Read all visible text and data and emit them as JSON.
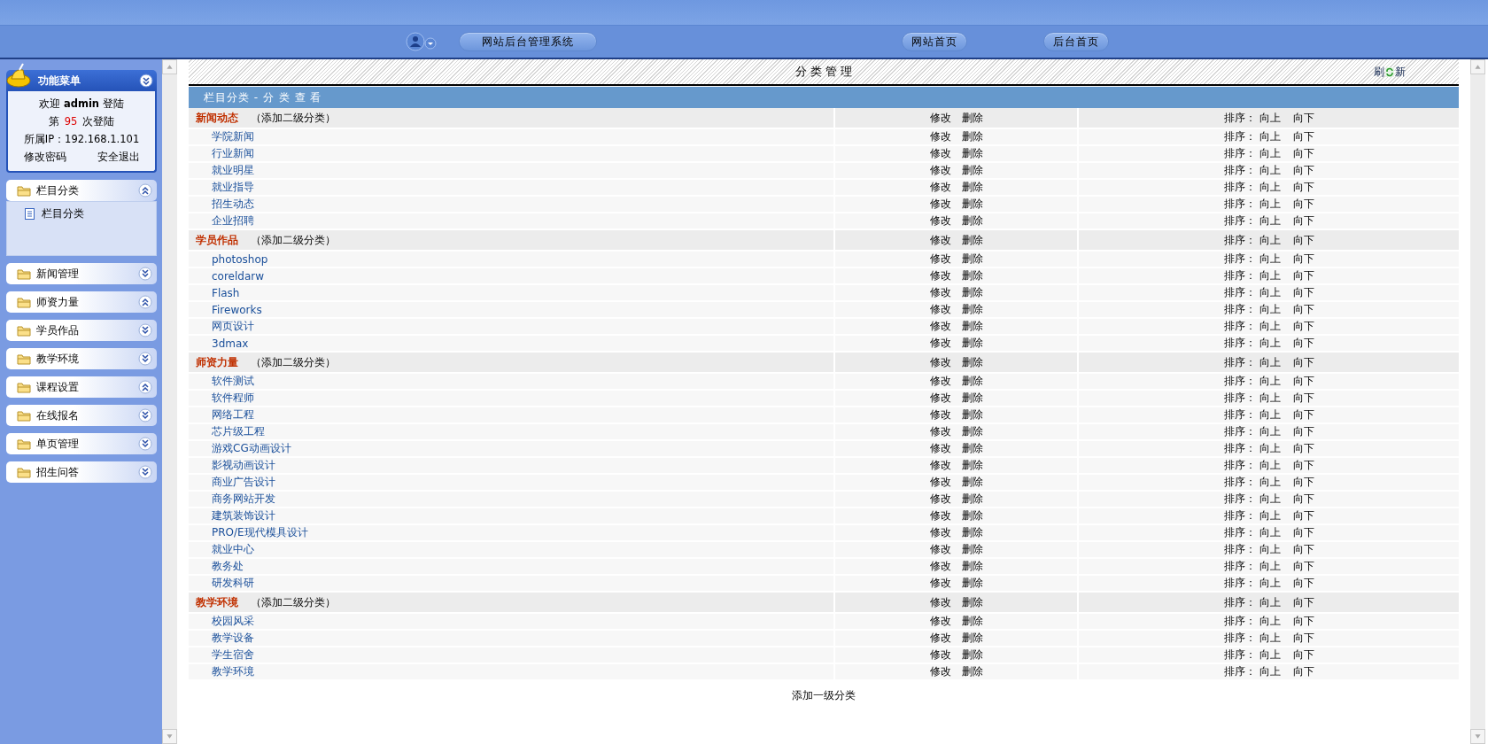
{
  "header": {
    "title_button": "网站后台管理系统",
    "nav_buttons": [
      "网站首页",
      "后台首页"
    ]
  },
  "sidebar": {
    "title": "功能菜单",
    "welcome": "欢迎 **admin** 登陆",
    "login_count": {
      "prefix": "第",
      "count": "95",
      "suffix": "次登陆"
    },
    "ip": "所属IP：192.168.1.101",
    "links": [
      "修改密码",
      "安全退出"
    ],
    "sections": [
      {
        "label": "栏目分类",
        "expanded": true,
        "children": [
          "栏目分类"
        ]
      },
      {
        "label": "新闻管理",
        "expanded": false
      },
      {
        "label": "师资力量",
        "expanded": true
      },
      {
        "label": "学员作品",
        "expanded": false
      },
      {
        "label": "教学环境",
        "expanded": false
      },
      {
        "label": "课程设置",
        "expanded": true
      },
      {
        "label": "在线报名",
        "expanded": false
      },
      {
        "label": "单页管理",
        "expanded": false
      },
      {
        "label": "招生问答",
        "expanded": false
      }
    ]
  },
  "panel": {
    "title": "分 类 管 理",
    "refresh": [
      "刷",
      "新"
    ],
    "subtitle": "栏目分类 - 分 类 查 看",
    "rows": [
      {
        "kind": "group",
        "name": "新闻动态",
        "add": "（添加二级分类）",
        "actions": [
          "修改",
          "删除"
        ],
        "sort": [
          "排序：",
          "向上",
          "向下"
        ]
      },
      {
        "kind": "child",
        "name": "学院新闻",
        "actions": [
          "修改",
          "删除"
        ],
        "sort": [
          "排序：",
          "向上",
          "向下"
        ]
      },
      {
        "kind": "child",
        "name": "行业新闻",
        "actions": [
          "修改",
          "删除"
        ],
        "sort": [
          "排序：",
          "向上",
          "向下"
        ]
      },
      {
        "kind": "child",
        "name": "就业明星",
        "actions": [
          "修改",
          "删除"
        ],
        "sort": [
          "排序：",
          "向上",
          "向下"
        ]
      },
      {
        "kind": "child",
        "name": "就业指导",
        "actions": [
          "修改",
          "删除"
        ],
        "sort": [
          "排序：",
          "向上",
          "向下"
        ]
      },
      {
        "kind": "child",
        "name": "招生动态",
        "actions": [
          "修改",
          "删除"
        ],
        "sort": [
          "排序：",
          "向上",
          "向下"
        ]
      },
      {
        "kind": "child",
        "name": "企业招聘",
        "actions": [
          "修改",
          "删除"
        ],
        "sort": [
          "排序：",
          "向上",
          "向下"
        ]
      },
      {
        "kind": "group",
        "name": "学员作品",
        "add": "（添加二级分类）",
        "actions": [
          "修改",
          "删除"
        ],
        "sort": [
          "排序：",
          "向上",
          "向下"
        ]
      },
      {
        "kind": "child",
        "name": "photoshop",
        "actions": [
          "修改",
          "删除"
        ],
        "sort": [
          "排序：",
          "向上",
          "向下"
        ]
      },
      {
        "kind": "child",
        "name": "coreldarw",
        "actions": [
          "修改",
          "删除"
        ],
        "sort": [
          "排序：",
          "向上",
          "向下"
        ]
      },
      {
        "kind": "child",
        "name": "Flash",
        "actions": [
          "修改",
          "删除"
        ],
        "sort": [
          "排序：",
          "向上",
          "向下"
        ]
      },
      {
        "kind": "child",
        "name": "Fireworks",
        "actions": [
          "修改",
          "删除"
        ],
        "sort": [
          "排序：",
          "向上",
          "向下"
        ]
      },
      {
        "kind": "child",
        "name": "网页设计",
        "actions": [
          "修改",
          "删除"
        ],
        "sort": [
          "排序：",
          "向上",
          "向下"
        ]
      },
      {
        "kind": "child",
        "name": "3dmax",
        "actions": [
          "修改",
          "删除"
        ],
        "sort": [
          "排序：",
          "向上",
          "向下"
        ]
      },
      {
        "kind": "group",
        "name": "师资力量",
        "add": "（添加二级分类）",
        "actions": [
          "修改",
          "删除"
        ],
        "sort": [
          "排序：",
          "向上",
          "向下"
        ]
      },
      {
        "kind": "child",
        "name": "软件测试",
        "actions": [
          "修改",
          "删除"
        ],
        "sort": [
          "排序：",
          "向上",
          "向下"
        ]
      },
      {
        "kind": "child",
        "name": "软件程师",
        "actions": [
          "修改",
          "删除"
        ],
        "sort": [
          "排序：",
          "向上",
          "向下"
        ]
      },
      {
        "kind": "child",
        "name": "网络工程",
        "actions": [
          "修改",
          "删除"
        ],
        "sort": [
          "排序：",
          "向上",
          "向下"
        ]
      },
      {
        "kind": "child",
        "name": "芯片级工程",
        "actions": [
          "修改",
          "删除"
        ],
        "sort": [
          "排序：",
          "向上",
          "向下"
        ]
      },
      {
        "kind": "child",
        "name": "游戏CG动画设计",
        "actions": [
          "修改",
          "删除"
        ],
        "sort": [
          "排序：",
          "向上",
          "向下"
        ]
      },
      {
        "kind": "child",
        "name": "影视动画设计",
        "actions": [
          "修改",
          "删除"
        ],
        "sort": [
          "排序：",
          "向上",
          "向下"
        ]
      },
      {
        "kind": "child",
        "name": "商业广告设计",
        "actions": [
          "修改",
          "删除"
        ],
        "sort": [
          "排序：",
          "向上",
          "向下"
        ]
      },
      {
        "kind": "child",
        "name": "商务网站开发",
        "actions": [
          "修改",
          "删除"
        ],
        "sort": [
          "排序：",
          "向上",
          "向下"
        ]
      },
      {
        "kind": "child",
        "name": "建筑装饰设计",
        "actions": [
          "修改",
          "删除"
        ],
        "sort": [
          "排序：",
          "向上",
          "向下"
        ]
      },
      {
        "kind": "child",
        "name": "PRO/E现代模具设计",
        "actions": [
          "修改",
          "删除"
        ],
        "sort": [
          "排序：",
          "向上",
          "向下"
        ]
      },
      {
        "kind": "child",
        "name": "就业中心",
        "actions": [
          "修改",
          "删除"
        ],
        "sort": [
          "排序：",
          "向上",
          "向下"
        ]
      },
      {
        "kind": "child",
        "name": "教务处",
        "actions": [
          "修改",
          "删除"
        ],
        "sort": [
          "排序：",
          "向上",
          "向下"
        ]
      },
      {
        "kind": "child",
        "name": "研发科研",
        "actions": [
          "修改",
          "删除"
        ],
        "sort": [
          "排序：",
          "向上",
          "向下"
        ]
      },
      {
        "kind": "group",
        "name": "教学环境",
        "add": "（添加二级分类）",
        "actions": [
          "修改",
          "删除"
        ],
        "sort": [
          "排序：",
          "向上",
          "向下"
        ]
      },
      {
        "kind": "child",
        "name": "校园风采",
        "actions": [
          "修改",
          "删除"
        ],
        "sort": [
          "排序：",
          "向上",
          "向下"
        ]
      },
      {
        "kind": "child",
        "name": "教学设备",
        "actions": [
          "修改",
          "删除"
        ],
        "sort": [
          "排序：",
          "向上",
          "向下"
        ]
      },
      {
        "kind": "child",
        "name": "学生宿舍",
        "actions": [
          "修改",
          "删除"
        ],
        "sort": [
          "排序：",
          "向上",
          "向下"
        ]
      },
      {
        "kind": "child",
        "name": "教学环境",
        "actions": [
          "修改",
          "删除"
        ],
        "sort": [
          "排序：",
          "向上",
          "向下"
        ]
      }
    ],
    "footer_link": "添加一级分类"
  }
}
